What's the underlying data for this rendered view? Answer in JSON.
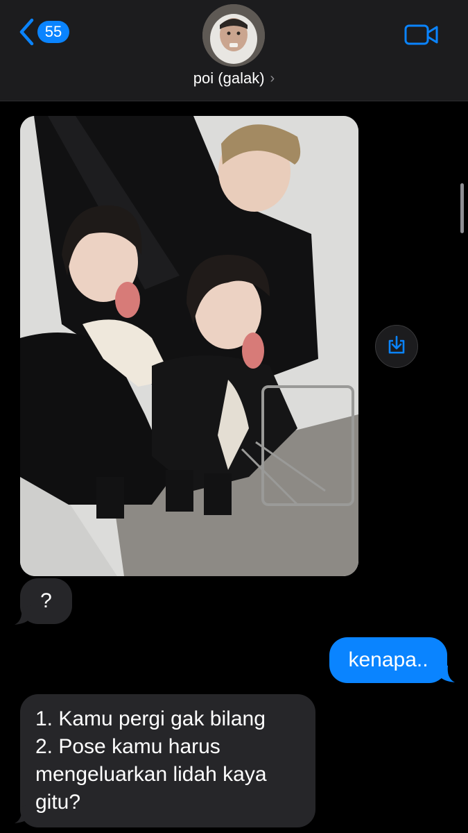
{
  "header": {
    "back_badge": "55",
    "contact_name": "poi (galak)",
    "contact_chevron": "›",
    "icons": {
      "back": "chevron-left-icon",
      "video": "video-call-icon"
    }
  },
  "conversation": {
    "photo": {
      "description_icon": "image"
    },
    "messages": [
      {
        "direction": "incoming",
        "text": "?"
      },
      {
        "direction": "outgoing",
        "text": "kenapa.."
      },
      {
        "direction": "incoming",
        "lines": [
          "1. Kamu pergi gak bilang",
          "2. Pose kamu harus",
          "mengeluarkan lidah kaya",
          "gitu?"
        ]
      }
    ]
  },
  "colors": {
    "accent": "#0a84ff",
    "incoming_bubble": "#262629",
    "header_bg": "#1c1c1e",
    "background": "#000000"
  }
}
